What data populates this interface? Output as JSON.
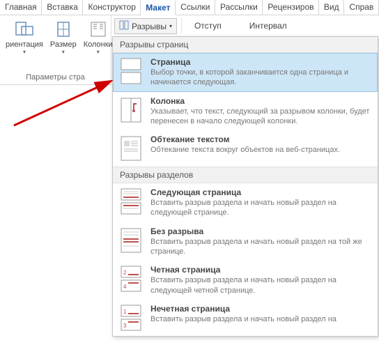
{
  "tabs": {
    "t0": "Главная",
    "t1": "Вставка",
    "t2": "Конструктор",
    "t3": "Макет",
    "t4": "Ссылки",
    "t5": "Рассылки",
    "t6": "Рецензиров",
    "t7": "Вид",
    "t8": "Справ"
  },
  "ribbon": {
    "orientation": "риентация",
    "size": "Размер",
    "columns": "Колонки",
    "group_title": "Параметры стра",
    "breaks_label": "Разрывы",
    "indent_label": "Отступ",
    "interval_label": "Интервал"
  },
  "dropdown": {
    "section1": "Разрывы страниц",
    "section2": "Разрывы разделов",
    "items": {
      "page": {
        "title": "Страница",
        "desc": "Выбор точки, в которой заканчивается одна страница и начинается следующая."
      },
      "column": {
        "title": "Колонка",
        "desc": "Указывает, что текст, следующий за разрывом колонки, будет перенесен в начало следующей колонки."
      },
      "textwrap": {
        "title": "Обтекание текстом",
        "desc": "Обтекание текста вокруг объектов на веб-страницах."
      },
      "nextpage": {
        "title": "Следующая страница",
        "desc": "Вставить разрыв раздела и начать новый раздел на следующей странице."
      },
      "continuous": {
        "title": "Без разрыва",
        "desc": "Вставить разрыв раздела и начать новый раздел на той же странице."
      },
      "evenpage": {
        "title": "Четная страница",
        "desc": "Вставить разрыв раздела и начать новый раздел на следующей четной странице."
      },
      "oddpage": {
        "title": "Нечетная страница",
        "desc": "Вставить разрыв раздела и начать новый раздел на"
      }
    }
  }
}
